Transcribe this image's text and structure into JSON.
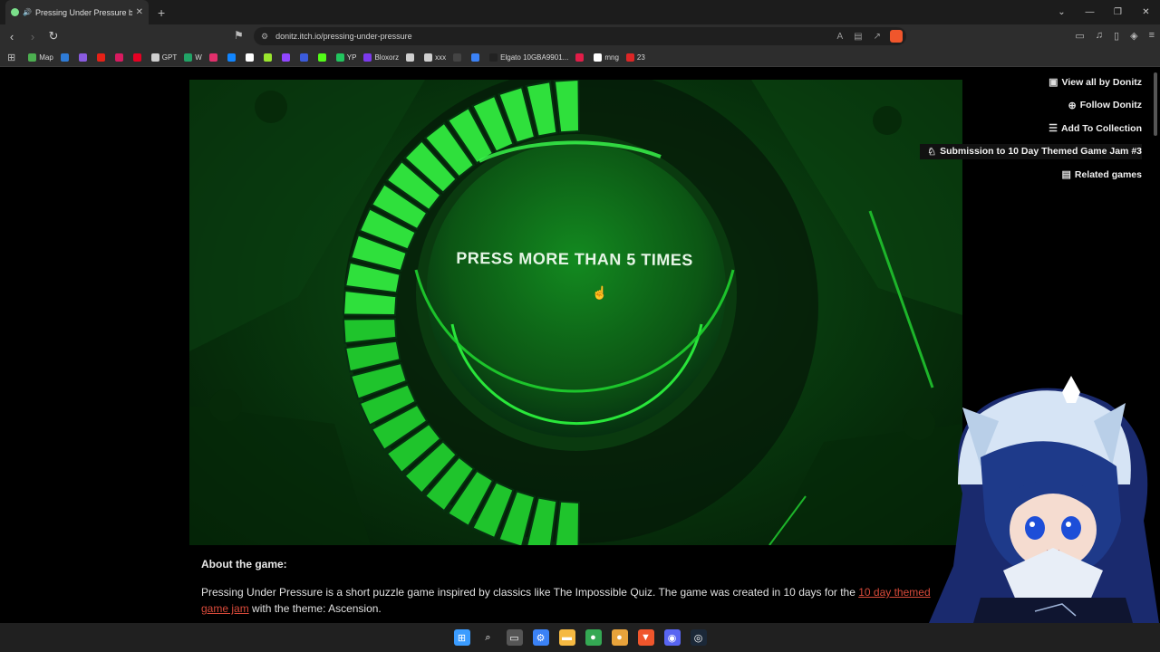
{
  "browser": {
    "tab_title": "Pressing Under Pressure by D",
    "tab_close": "✕",
    "new_tab": "+",
    "url": "donitz.itch.io/pressing-under-pressure",
    "window_controls": [
      "⌄",
      "—",
      "❐",
      "✕"
    ]
  },
  "bookmarks": [
    {
      "label": "Map",
      "color": "#4caf50"
    },
    {
      "label": "",
      "color": "#2e7bd6"
    },
    {
      "label": "",
      "color": "#8a5be0"
    },
    {
      "label": "",
      "color": "#e62117"
    },
    {
      "label": "",
      "color": "#d81b60"
    },
    {
      "label": "",
      "color": "#e60023"
    },
    {
      "label": "GPT",
      "color": "#cfcfcf"
    },
    {
      "label": "W",
      "color": "#21a366"
    },
    {
      "label": "",
      "color": "#e1306c"
    },
    {
      "label": "",
      "color": "#1185fe"
    },
    {
      "label": "",
      "color": "#ffffff"
    },
    {
      "label": "",
      "color": "#9ae62e"
    },
    {
      "label": "",
      "color": "#9146ff"
    },
    {
      "label": "",
      "color": "#3b5bdb"
    },
    {
      "label": "",
      "color": "#53fc18"
    },
    {
      "label": "YP",
      "color": "#22c55e"
    },
    {
      "label": "Bloxorz",
      "color": "#7c3aed"
    },
    {
      "label": "",
      "color": "#cfcfcf"
    },
    {
      "label": "xxx",
      "color": "#cfcfcf"
    },
    {
      "label": "",
      "color": "#444444"
    },
    {
      "label": "",
      "color": "#3b82f6"
    },
    {
      "label": "Elgato 10GBA9901...",
      "color": "#222222"
    },
    {
      "label": "",
      "color": "#e11d48"
    },
    {
      "label": "mng",
      "color": "#ffffff"
    },
    {
      "label": "23",
      "color": "#dc2626"
    }
  ],
  "game": {
    "prompt": "PRESS MORE THAN 5 TIMES",
    "progress_filled_segments": 26,
    "progress_total_segments": 26
  },
  "sidebar": {
    "links": [
      {
        "label": "View all by Donitz",
        "icon": "▣"
      },
      {
        "label": "Follow Donitz",
        "icon": "⊕"
      },
      {
        "label": "Add To Collection",
        "icon": "☰"
      },
      {
        "label": "Submission to 10 Day Themed Game Jam #3",
        "icon": "♘"
      },
      {
        "label": "Related games",
        "icon": "▤"
      }
    ]
  },
  "about": {
    "heading": "About the game:",
    "text_before": "Pressing Under Pressure is a short puzzle game inspired by classics like The Impossible Quiz. The game was created in 10 days for the ",
    "link": "10 day themed game jam",
    "text_after": " with the theme: Ascension."
  },
  "taskbar": [
    {
      "name": "start",
      "color": "#3b9cff",
      "glyph": "⊞"
    },
    {
      "name": "search",
      "color": "#202020",
      "glyph": "⌕"
    },
    {
      "name": "task-view",
      "color": "#555555",
      "glyph": "▭"
    },
    {
      "name": "settings",
      "color": "#3b82f6",
      "glyph": "⚙"
    },
    {
      "name": "explorer",
      "color": "#f5b942",
      "glyph": "▬"
    },
    {
      "name": "chrome",
      "color": "#34a853",
      "glyph": "●"
    },
    {
      "name": "chrome-dev",
      "color": "#e8a33b",
      "glyph": "●"
    },
    {
      "name": "brave",
      "color": "#f0562c",
      "glyph": "▼"
    },
    {
      "name": "discord",
      "color": "#5865f2",
      "glyph": "◉"
    },
    {
      "name": "steam",
      "color": "#1b2838",
      "glyph": "◎"
    }
  ]
}
